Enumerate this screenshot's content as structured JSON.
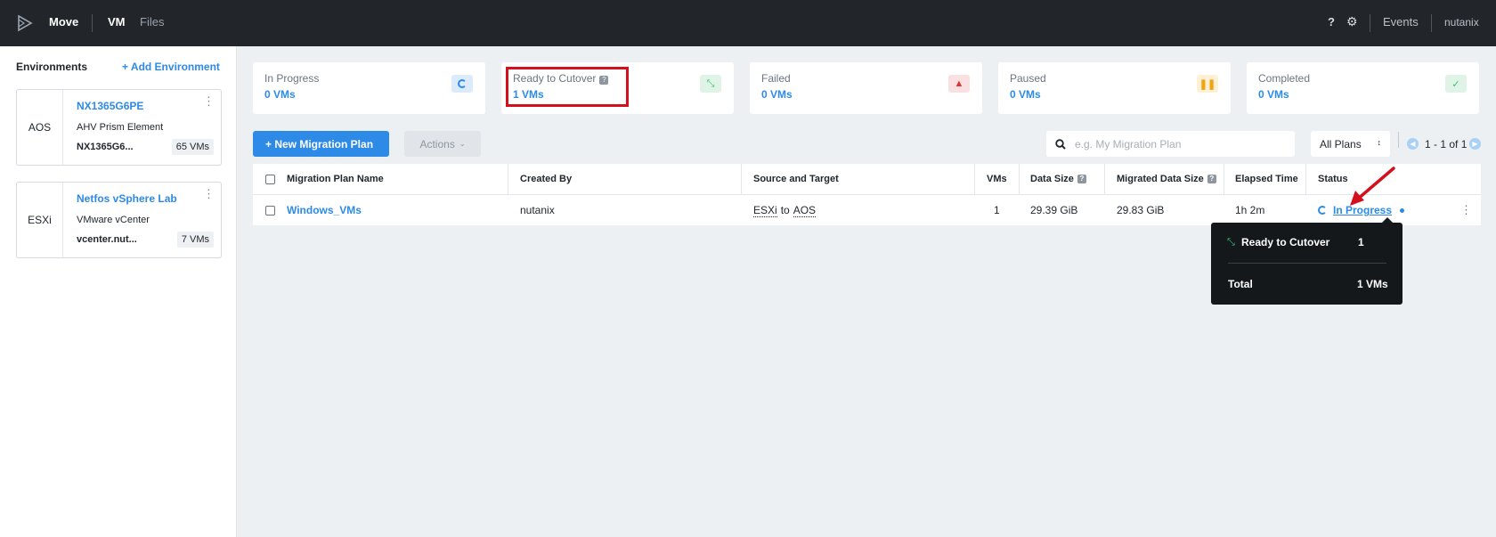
{
  "header": {
    "app_name": "Move",
    "tabs": [
      "VM",
      "Files"
    ],
    "help": "?",
    "events": "Events",
    "user": "nutanix"
  },
  "sidebar": {
    "title": "Environments",
    "add_label": "+ Add Environment",
    "environments": [
      {
        "type": "AOS",
        "name": "NX1365G6PE",
        "kind": "AHV Prism Element",
        "host": "NX1365G6...",
        "count": "65 VMs"
      },
      {
        "type": "ESXi",
        "name": "Netfos vSphere Lab",
        "kind": "VMware vCenter",
        "host": "vcenter.nut...",
        "count": "7 VMs"
      }
    ]
  },
  "summary": [
    {
      "label": "In Progress",
      "value": "0 VMs",
      "icon": "spinner-icon",
      "color": "#2d8ae6",
      "bg": "#dcebfb"
    },
    {
      "label": "Ready to Cutover",
      "value": "1 VMs",
      "icon": "cutover-icon",
      "color": "#36c27a",
      "bg": "#dff3e7",
      "help": "?"
    },
    {
      "label": "Failed",
      "value": "0 VMs",
      "icon": "warning-icon",
      "color": "#e0303a",
      "bg": "#fbe0e1"
    },
    {
      "label": "Paused",
      "value": "0 VMs",
      "icon": "pause-icon",
      "color": "#f2a20a",
      "bg": "#fdf0d6"
    },
    {
      "label": "Completed",
      "value": "0 VMs",
      "icon": "check-icon",
      "color": "#36c27a",
      "bg": "#dff3e7"
    }
  ],
  "toolbar": {
    "new_plan": "+ New Migration Plan",
    "actions": "Actions",
    "search_placeholder": "e.g. My Migration Plan",
    "plans_filter": "All Plans",
    "pagination": "1 - 1 of 1"
  },
  "table": {
    "headers": {
      "name": "Migration Plan Name",
      "created_by": "Created By",
      "source_target": "Source and Target",
      "vms": "VMs",
      "data_size": "Data Size",
      "migrated": "Migrated Data Size",
      "elapsed": "Elapsed Time",
      "status": "Status"
    },
    "rows": [
      {
        "name": "Windows_VMs",
        "created_by": "nutanix",
        "source": "ESXi",
        "to": "to",
        "target": "AOS",
        "vms": "1",
        "data_size": "29.39 GiB",
        "migrated": "29.83 GiB",
        "elapsed": "1h 2m",
        "status": "In Progress"
      }
    ]
  },
  "tooltip": {
    "label": "Ready to Cutover",
    "value": "1",
    "total_label": "Total",
    "total_value": "1 VMs"
  }
}
